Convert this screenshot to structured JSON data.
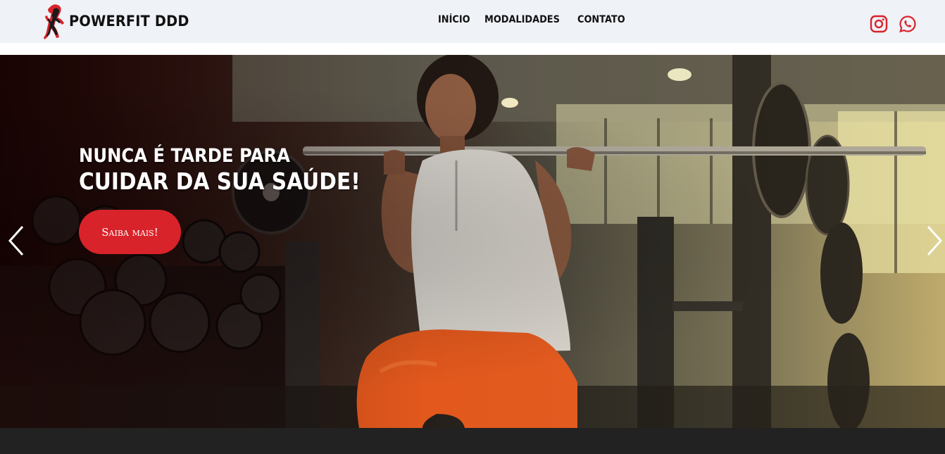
{
  "brand": {
    "name": "POWERFIT DDD",
    "accent_color": "#d8232a",
    "logo_icon": "athlete-logo-icon"
  },
  "nav": {
    "links": [
      {
        "label": "INÍCIO"
      },
      {
        "label": "MODALIDADES"
      },
      {
        "label": "CONTATO"
      }
    ]
  },
  "social": {
    "instagram_icon": "instagram-icon",
    "whatsapp_icon": "whatsapp-icon",
    "color": "#d8232a"
  },
  "hero": {
    "title_line1": "NUNCA É TARDE PARA",
    "title_line2": "CUIDAR DA SUA SAÚDE!",
    "cta_label": "Saiba mais!",
    "prev_icon": "chevron-left-icon",
    "next_icon": "chevron-right-icon",
    "image_icon": "gym-squat-photo"
  }
}
